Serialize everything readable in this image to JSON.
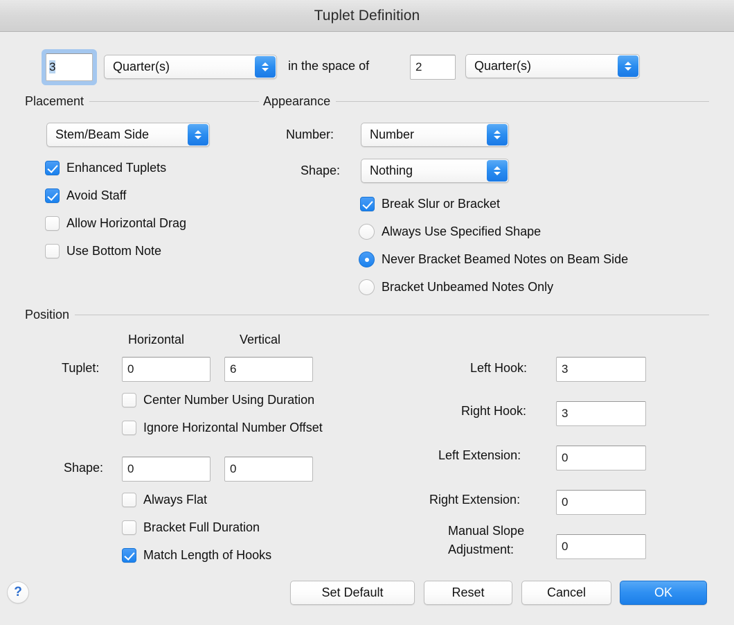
{
  "window": {
    "title": "Tuplet Definition"
  },
  "ratio": {
    "count_value": "3",
    "count_unit": "Quarter(s)",
    "in_the_space_of": "in the space of",
    "space_value": "2",
    "space_unit": "Quarter(s)"
  },
  "placement": {
    "title": "Placement",
    "side_popup": "Stem/Beam Side",
    "checkboxes": [
      {
        "label": "Enhanced Tuplets",
        "checked": true
      },
      {
        "label": "Avoid Staff",
        "checked": true
      },
      {
        "label": "Allow Horizontal Drag",
        "checked": false
      },
      {
        "label": "Use Bottom Note",
        "checked": false
      }
    ]
  },
  "appearance": {
    "title": "Appearance",
    "number_label": "Number:",
    "number_value": "Number",
    "shape_label": "Shape:",
    "shape_value": "Nothing",
    "break_slur": {
      "label": "Break Slur or Bracket",
      "checked": true
    },
    "radios": [
      {
        "label": "Always Use Specified Shape",
        "selected": false
      },
      {
        "label": "Never Bracket Beamed Notes on Beam Side",
        "selected": true
      },
      {
        "label": "Bracket Unbeamed Notes Only",
        "selected": false
      }
    ]
  },
  "position": {
    "title": "Position",
    "col_horizontal": "Horizontal",
    "col_vertical": "Vertical",
    "tuplet_label": "Tuplet:",
    "tuplet_h": "0",
    "tuplet_v": "6",
    "center_number": {
      "label": "Center Number Using Duration",
      "checked": false
    },
    "ignore_offset": {
      "label": "Ignore Horizontal Number Offset",
      "checked": false
    },
    "shape_label": "Shape:",
    "shape_h": "0",
    "shape_v": "0",
    "always_flat": {
      "label": "Always Flat",
      "checked": false
    },
    "bracket_full": {
      "label": "Bracket Full Duration",
      "checked": false
    },
    "match_hooks": {
      "label": "Match Length of Hooks",
      "checked": true
    },
    "left_hook_label": "Left Hook:",
    "left_hook": "3",
    "right_hook_label": "Right Hook:",
    "right_hook": "3",
    "left_ext_label": "Left Extension:",
    "left_ext": "0",
    "right_ext_label": "Right Extension:",
    "right_ext": "0",
    "slope_label_line1": "Manual Slope",
    "slope_label_line2": "Adjustment:",
    "slope": "0"
  },
  "footer": {
    "help": "?",
    "set_default": "Set Default",
    "reset": "Reset",
    "cancel": "Cancel",
    "ok": "OK"
  },
  "colors": {
    "accent": "#2a8cf0",
    "window_bg": "#ececec",
    "focus_ring": "#a4c7ef"
  }
}
